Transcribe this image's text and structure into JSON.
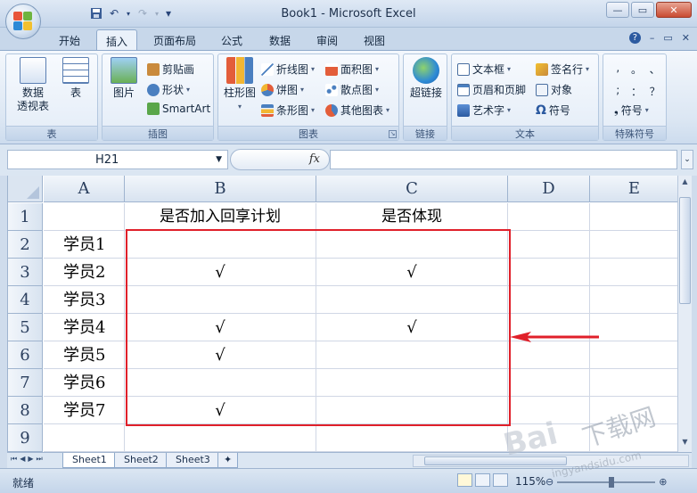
{
  "window": {
    "title": "Book1 - Microsoft Excel",
    "minimize": "—",
    "restore": "▭",
    "close": "✕"
  },
  "qat": {
    "save_icon": "save-icon",
    "undo": "↶",
    "redo": "↷",
    "customize": "▾"
  },
  "tabs": [
    {
      "label": "开始"
    },
    {
      "label": "插入"
    },
    {
      "label": "页面布局"
    },
    {
      "label": "公式"
    },
    {
      "label": "数据"
    },
    {
      "label": "审阅"
    },
    {
      "label": "视图"
    }
  ],
  "ribbon_controls": {
    "help": "?",
    "minimize": "–",
    "restore": "▭",
    "close": "✕"
  },
  "ribbon": {
    "tables": {
      "label": "表",
      "pivot": "数据\n透视表",
      "table": "表"
    },
    "illustrations": {
      "label": "插图",
      "picture": "图片",
      "clipart": "剪贴画",
      "shapes": "形状",
      "smartart": "SmartArt"
    },
    "charts": {
      "label": "图表",
      "column": "柱形图",
      "line": "折线图",
      "pie": "饼图",
      "bar": "条形图",
      "area": "面积图",
      "scatter": "散点图",
      "other": "其他图表"
    },
    "links": {
      "label": "链接",
      "hyperlink": "超链接"
    },
    "text": {
      "label": "文本",
      "textbox": "文本框",
      "header_footer": "页眉和页脚",
      "wordart": "艺术字",
      "signature": "签名行",
      "object": "对象",
      "symbol": "符号"
    },
    "special": {
      "label": "特殊符号",
      "symbol": "符号",
      "chars": [
        ",",
        "。",
        "、",
        ";",
        "：",
        "？"
      ]
    }
  },
  "formula_bar": {
    "name_box": "H21",
    "fx": "fx",
    "value": ""
  },
  "columns": [
    "A",
    "B",
    "C",
    "D",
    "E"
  ],
  "rows": [
    "1",
    "2",
    "3",
    "4",
    "5",
    "6",
    "7",
    "8",
    "9"
  ],
  "cells": {
    "B1": "是否加入回享计划",
    "C1": "是否体现",
    "A2": "学员1",
    "A3": "学员2",
    "A4": "学员3",
    "A5": "学员4",
    "A6": "学员5",
    "A7": "学员6",
    "A8": "学员7",
    "B3": "√",
    "C3": "√",
    "B5": "√",
    "C5": "√",
    "B6": "√",
    "B8": "√"
  },
  "sheets": [
    {
      "label": "Sheet1"
    },
    {
      "label": "Sheet2"
    },
    {
      "label": "Sheet3"
    }
  ],
  "status": {
    "ready": "就绪",
    "zoom": "115%"
  },
  "colors": {
    "highlight_box": "#e0202a",
    "arrow": "#e0202a"
  },
  "watermark": {
    "big": "下载网",
    "small": "Bai",
    "url": "ingyandsidu.com"
  }
}
